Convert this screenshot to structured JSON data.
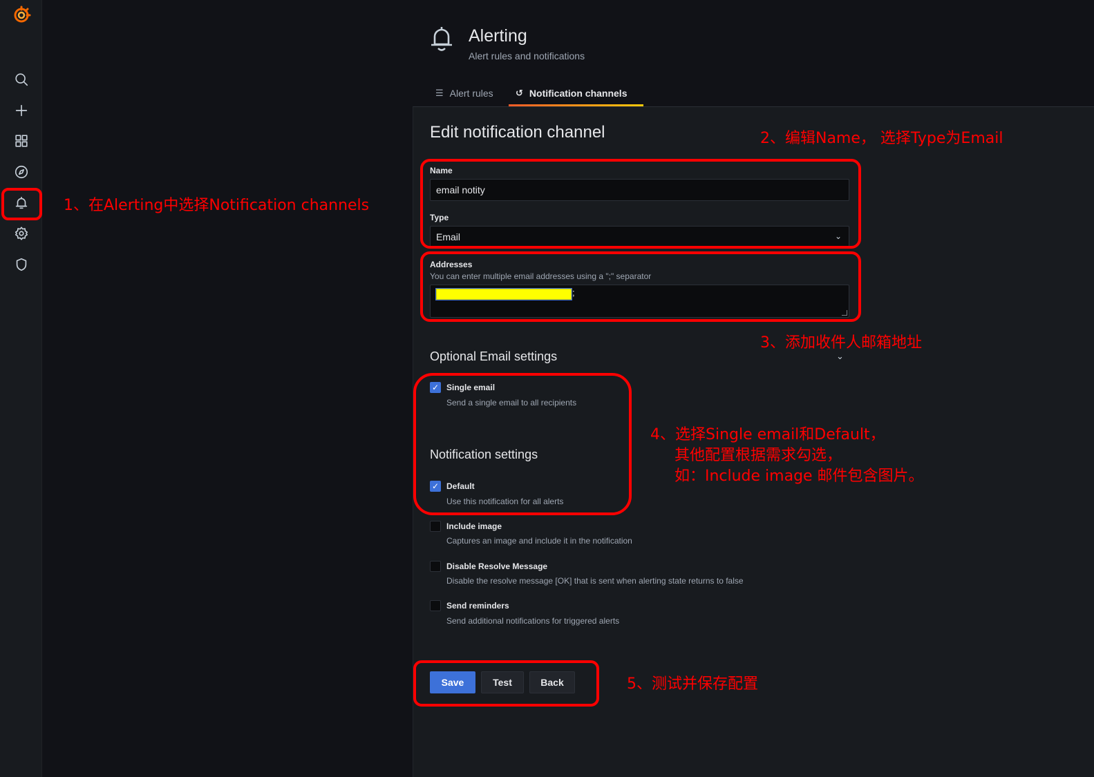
{
  "sidebar": {
    "items": [
      {
        "name": "grafana-logo-icon"
      },
      {
        "name": "search-icon"
      },
      {
        "name": "plus-icon"
      },
      {
        "name": "dashboards-icon"
      },
      {
        "name": "compass-icon"
      },
      {
        "name": "bell-icon"
      },
      {
        "name": "gear-icon"
      },
      {
        "name": "shield-icon"
      }
    ]
  },
  "header": {
    "title": "Alerting",
    "subtitle": "Alert rules and notifications"
  },
  "tabs": [
    {
      "label": "Alert rules",
      "icon": "list-icon",
      "active": false
    },
    {
      "label": "Notification channels",
      "icon": "comment-alt-share-icon",
      "active": true
    }
  ],
  "form": {
    "heading": "Edit notification channel",
    "name_label": "Name",
    "name_value": "email notity",
    "type_label": "Type",
    "type_value": "Email",
    "addresses_label": "Addresses",
    "addresses_desc": "You can enter multiple email addresses using a \";\" separator",
    "addresses_suffix": ";",
    "optional_heading": "Optional Email settings",
    "single_email_label": "Single email",
    "single_email_desc": "Send a single email to all recipients",
    "notification_heading": "Notification settings",
    "options": [
      {
        "label": "Default",
        "desc": "Use this notification for all alerts",
        "checked": true
      },
      {
        "label": "Include image",
        "desc": "Captures an image and include it in the notification",
        "checked": false
      },
      {
        "label": "Disable Resolve Message",
        "desc": "Disable the resolve message [OK] that is sent when alerting state returns to false",
        "checked": false
      },
      {
        "label": "Send reminders",
        "desc": "Send additional notifications for triggered alerts",
        "checked": false
      }
    ],
    "buttons": {
      "save": "Save",
      "test": "Test",
      "back": "Back"
    }
  },
  "annotations": {
    "a1": "1、在Alerting中选择Notification channels",
    "a2": "2、编辑Name， 选择Type为Email",
    "a3": "3、添加收件人邮箱地址",
    "a4": "4、选择Single email和Default，\n     其他配置根据需求勾选，\n     如：Include image 邮件包含图片。",
    "a5": "5、测试并保存配置"
  },
  "colors": {
    "primary": "#3d71d9",
    "annotation": "#ff0000",
    "highlight": "#ffff00",
    "tab_underline": "#f05a28"
  }
}
